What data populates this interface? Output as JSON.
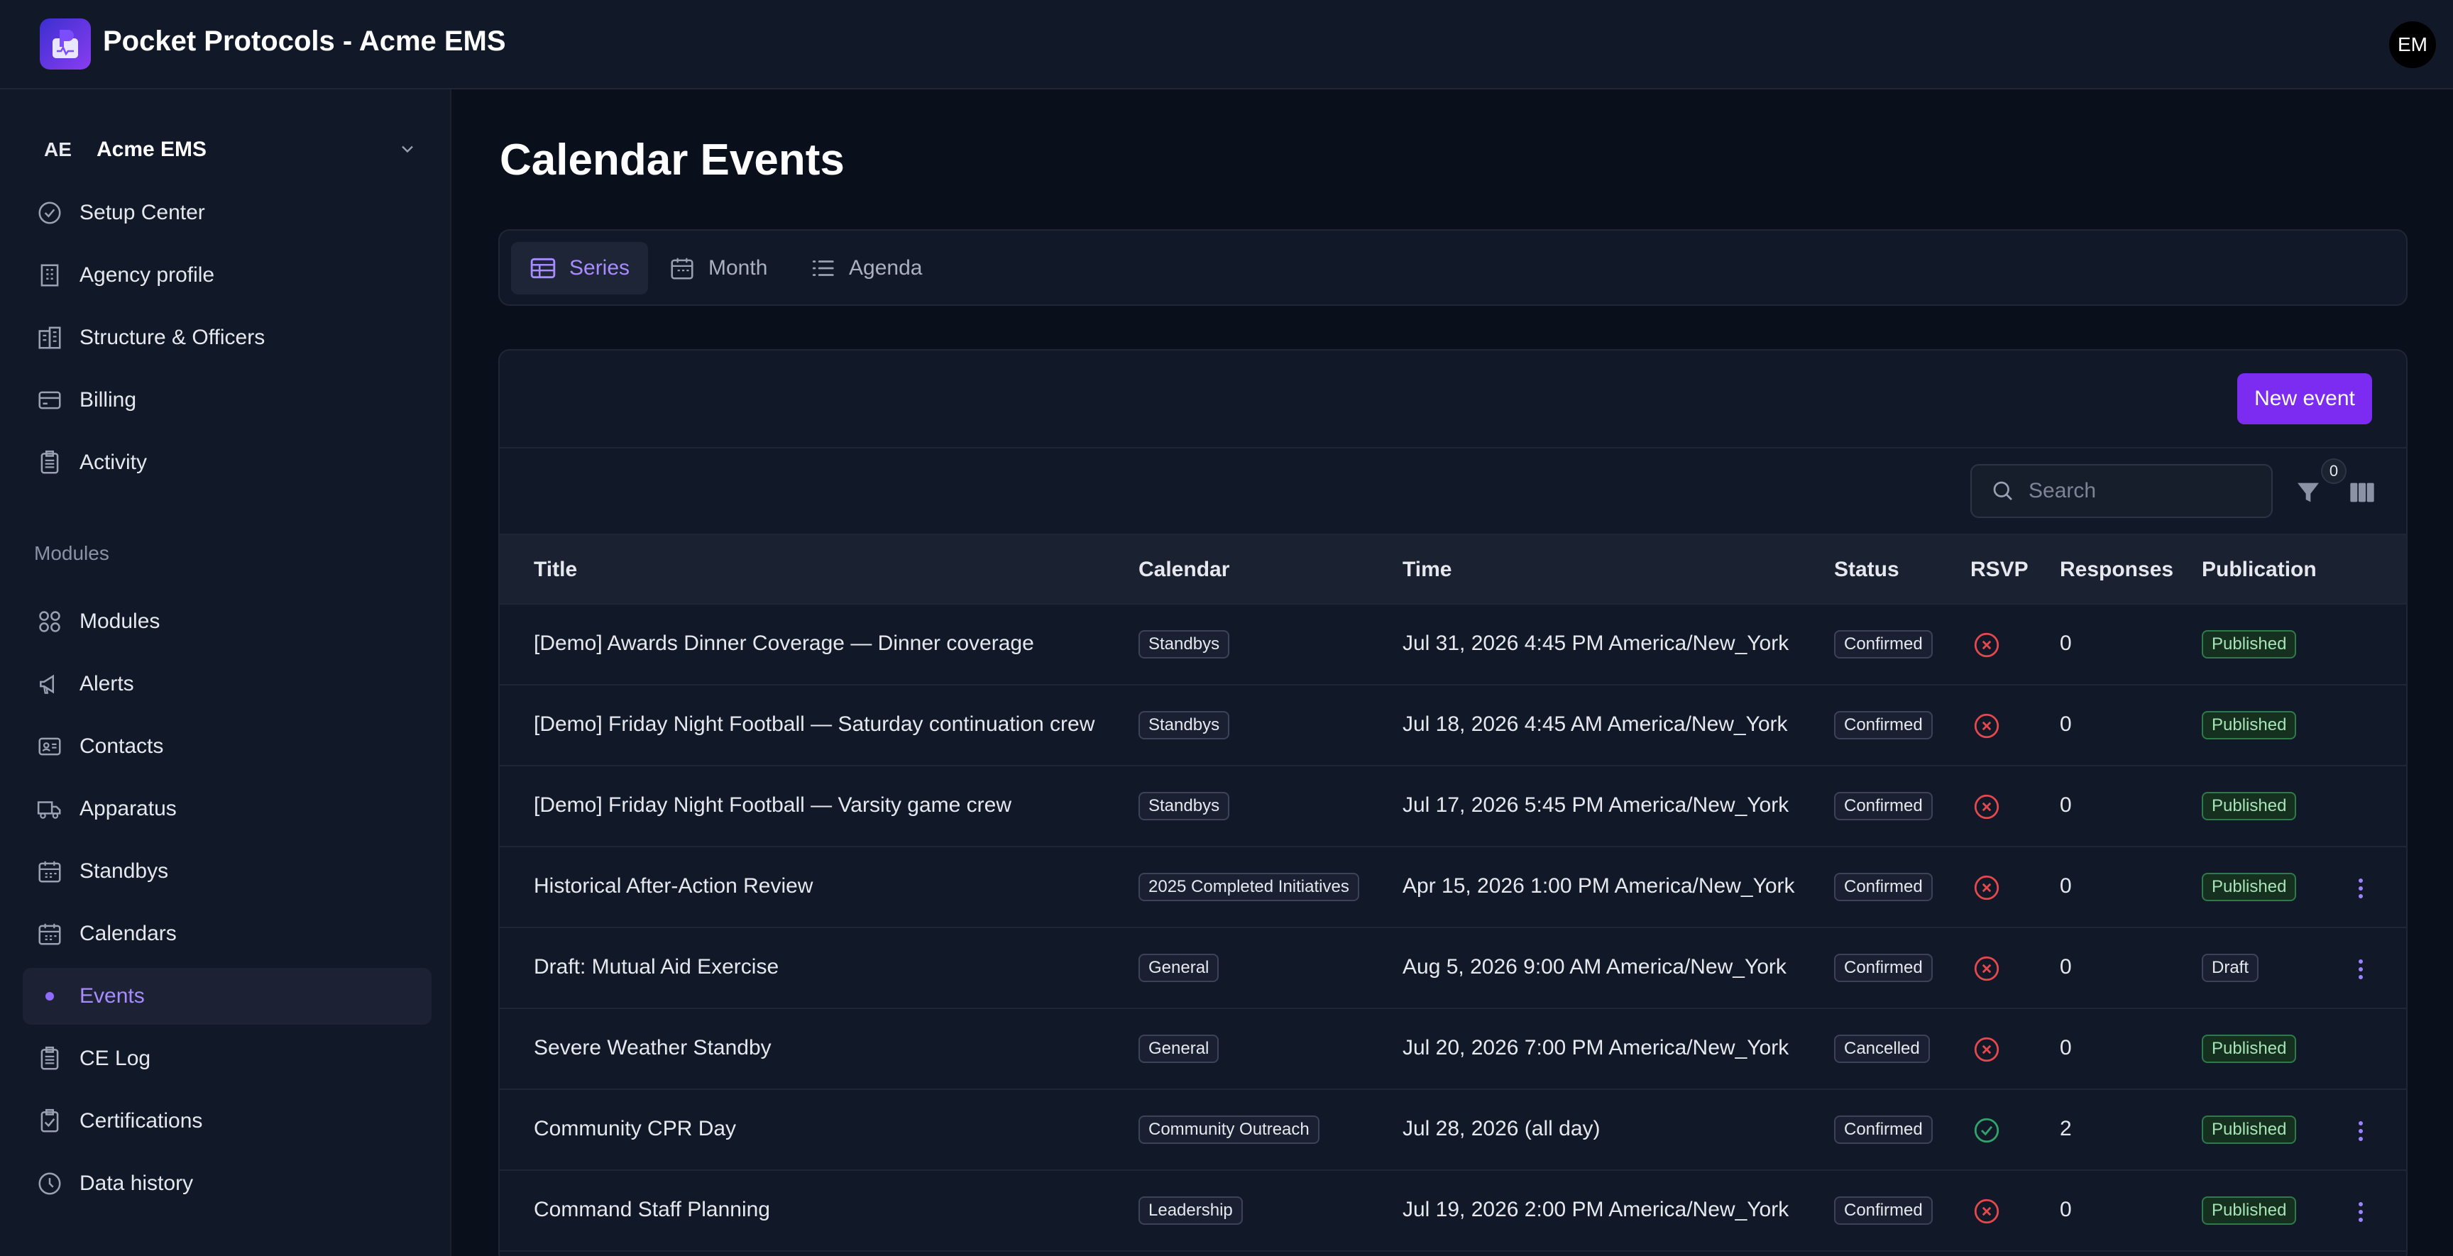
{
  "app": {
    "title": "Pocket Protocols - Acme EMS",
    "avatar": "EM"
  },
  "org": {
    "abbrev": "AE",
    "name": "Acme EMS"
  },
  "sidebar": {
    "admin_items": [
      {
        "label": "Setup Center",
        "icon": "check-circle-icon"
      },
      {
        "label": "Agency profile",
        "icon": "building-icon"
      },
      {
        "label": "Structure & Officers",
        "icon": "buildings-icon"
      },
      {
        "label": "Billing",
        "icon": "credit-card-icon"
      },
      {
        "label": "Activity",
        "icon": "clipboard-icon"
      }
    ],
    "section_label": "Modules",
    "module_items": [
      {
        "label": "Modules",
        "icon": "grid-icon"
      },
      {
        "label": "Alerts",
        "icon": "megaphone-icon"
      },
      {
        "label": "Contacts",
        "icon": "id-card-icon"
      },
      {
        "label": "Apparatus",
        "icon": "truck-icon"
      },
      {
        "label": "Standbys",
        "icon": "calendar-icon"
      },
      {
        "label": "Calendars",
        "icon": "calendar-icon"
      },
      {
        "label": "Events",
        "icon": "dot-icon",
        "active": true
      },
      {
        "label": "CE Log",
        "icon": "clipboard-icon"
      },
      {
        "label": "Certifications",
        "icon": "clipboard-check-icon"
      },
      {
        "label": "Data history",
        "icon": "clock-icon"
      }
    ]
  },
  "main": {
    "title": "Calendar Events",
    "tabs": [
      {
        "label": "Series",
        "active": true
      },
      {
        "label": "Month"
      },
      {
        "label": "Agenda"
      }
    ],
    "new_button": "New event",
    "search_placeholder": "Search",
    "filter_count": "0",
    "columns": [
      "Title",
      "Calendar",
      "Time",
      "Status",
      "RSVP",
      "Responses",
      "Publication"
    ],
    "rows": [
      {
        "title": "[Demo] Awards Dinner Coverage — Dinner coverage",
        "calendar": "Standbys",
        "time": "Jul 31, 2026 4:45 PM America/New_York",
        "status": "Confirmed",
        "rsvp": false,
        "responses": "0",
        "publication": "Published",
        "menu": false
      },
      {
        "title": "[Demo] Friday Night Football — Saturday continuation crew",
        "calendar": "Standbys",
        "time": "Jul 18, 2026 4:45 AM America/New_York",
        "status": "Confirmed",
        "rsvp": false,
        "responses": "0",
        "publication": "Published",
        "menu": false
      },
      {
        "title": "[Demo] Friday Night Football — Varsity game crew",
        "calendar": "Standbys",
        "time": "Jul 17, 2026 5:45 PM America/New_York",
        "status": "Confirmed",
        "rsvp": false,
        "responses": "0",
        "publication": "Published",
        "menu": false
      },
      {
        "title": "Historical After-Action Review",
        "calendar": "2025 Completed Initiatives",
        "time": "Apr 15, 2026 1:00 PM America/New_York",
        "status": "Confirmed",
        "rsvp": false,
        "responses": "0",
        "publication": "Published",
        "menu": true
      },
      {
        "title": "Draft: Mutual Aid Exercise",
        "calendar": "General",
        "time": "Aug 5, 2026 9:00 AM America/New_York",
        "status": "Confirmed",
        "rsvp": false,
        "responses": "0",
        "publication": "Draft",
        "menu": true
      },
      {
        "title": "Severe Weather Standby",
        "calendar": "General",
        "time": "Jul 20, 2026 7:00 PM America/New_York",
        "status": "Cancelled",
        "rsvp": false,
        "responses": "0",
        "publication": "Published",
        "menu": false
      },
      {
        "title": "Community CPR Day",
        "calendar": "Community Outreach",
        "time": "Jul 28, 2026 (all day)",
        "status": "Confirmed",
        "rsvp": true,
        "responses": "2",
        "publication": "Published",
        "menu": true
      },
      {
        "title": "Command Staff Planning",
        "calendar": "Leadership",
        "time": "Jul 19, 2026 2:00 PM America/New_York",
        "status": "Confirmed",
        "rsvp": false,
        "responses": "0",
        "publication": "Published",
        "menu": true
      }
    ]
  },
  "colors": {
    "accent": "#7c2bf0",
    "active_text": "#a88bff",
    "rsvp_no": "#e5484d",
    "rsvp_yes": "#30a46c"
  }
}
